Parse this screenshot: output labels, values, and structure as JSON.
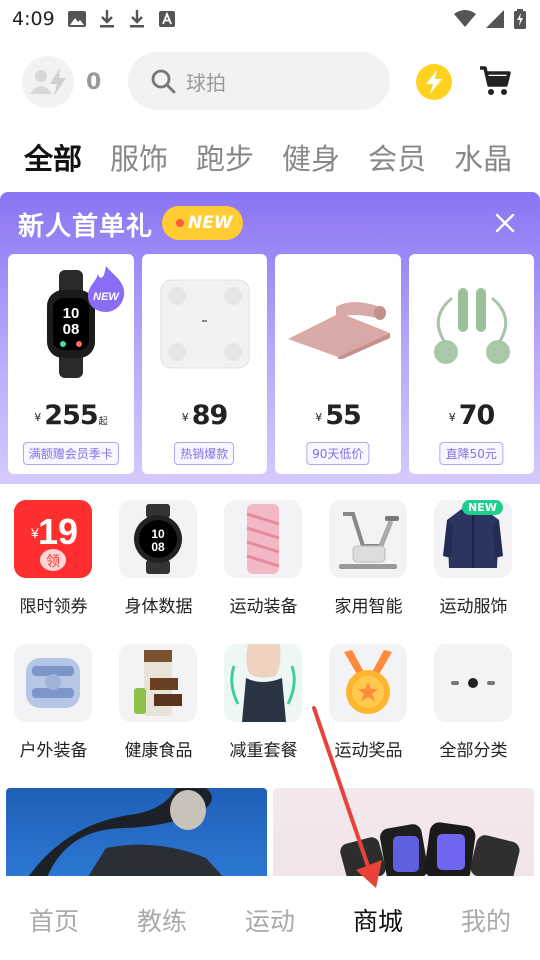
{
  "status_bar": {
    "time": "4:09",
    "icons": [
      "image-icon",
      "download-icon",
      "download-icon",
      "font-icon",
      "wifi-icon",
      "signal-icon",
      "battery-icon"
    ]
  },
  "header": {
    "user_count": "0",
    "search_placeholder": "球拍",
    "accent_color": "#ffd21f"
  },
  "tabs": [
    {
      "label": "全部",
      "active": true
    },
    {
      "label": "服饰"
    },
    {
      "label": "跑步"
    },
    {
      "label": "健身"
    },
    {
      "label": "会员"
    },
    {
      "label": "水晶"
    }
  ],
  "banner": {
    "title": "新人首单礼",
    "new_tag": "NEW",
    "products": [
      {
        "image": "smart-band",
        "yen": "¥",
        "price": "255",
        "suffix": "起",
        "tag": "满额赠会员季卡",
        "badge": "NEW"
      },
      {
        "image": "smart-scale",
        "yen": "¥",
        "price": "89",
        "suffix": "",
        "tag": "热销爆款"
      },
      {
        "image": "yoga-mat",
        "yen": "¥",
        "price": "55",
        "suffix": "",
        "tag": "90天低价"
      },
      {
        "image": "jump-rope",
        "yen": "¥",
        "price": "70",
        "suffix": "",
        "tag": "直降50元"
      }
    ]
  },
  "categories": [
    {
      "label": "限时领券",
      "icon": "coupon-19",
      "coupon_yen": "¥",
      "coupon_value": "19",
      "coupon_sub": "领"
    },
    {
      "label": "身体数据",
      "icon": "smartwatch-icon",
      "watch_text": "10\n08"
    },
    {
      "label": "运动装备",
      "icon": "foam-roller-icon"
    },
    {
      "label": "家用智能",
      "icon": "exercise-bike-icon"
    },
    {
      "label": "运动服饰",
      "icon": "jacket-icon",
      "badge": "NEW"
    },
    {
      "label": "户外装备",
      "icon": "knee-brace-icon"
    },
    {
      "label": "健康食品",
      "icon": "protein-bar-icon"
    },
    {
      "label": "减重套餐",
      "icon": "waist-icon"
    },
    {
      "label": "运动奖品",
      "icon": "medal-icon"
    },
    {
      "label": "全部分类",
      "icon": "more-dots-icon"
    }
  ],
  "bottom_nav": [
    {
      "label": "首页"
    },
    {
      "label": "教练"
    },
    {
      "label": "运动"
    },
    {
      "label": "商城",
      "active": true
    },
    {
      "label": "我的"
    }
  ]
}
